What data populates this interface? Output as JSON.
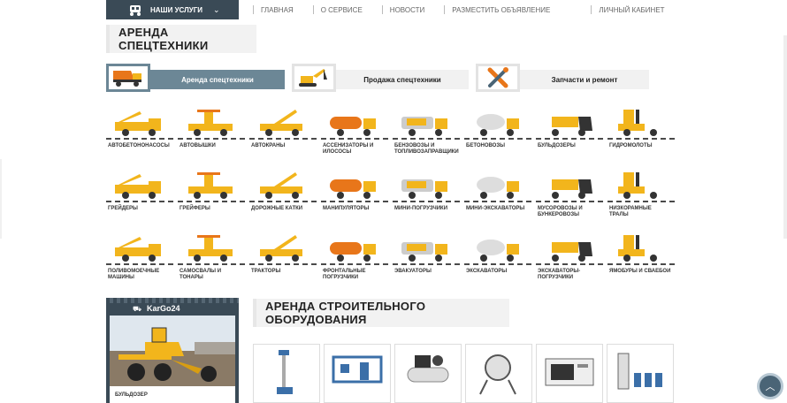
{
  "nav": {
    "services_label": "НАШИ УСЛУГИ",
    "links": [
      "ГЛАВНАЯ",
      "О СЕРВИСЕ",
      "НОВОСТИ",
      "РАЗМЕСТИТЬ ОБЪЯВЛЕНИЕ",
      "ЛИЧНЫЙ КАБИНЕТ"
    ]
  },
  "rental_section": {
    "title": "АРЕНДА СПЕЦТЕХНИКИ"
  },
  "tabs": [
    {
      "label": "Аренда спецтехники",
      "icon": "dump-truck-icon",
      "active": true
    },
    {
      "label": "Продажа спецтехники",
      "icon": "excavator-icon",
      "active": false
    },
    {
      "label": "Запчасти и ремонт",
      "icon": "wrench-screwdriver-icon",
      "active": false
    }
  ],
  "machines": [
    [
      "АВТОБЕТОНОНАСОСЫ"
    ],
    [
      "АВТОВЫШКИ"
    ],
    [
      "АВТОКРАНЫ"
    ],
    [
      "АССЕНИЗАТОРЫ И",
      "ИЛОСОСЫ"
    ],
    [
      "БЕНЗОВОЗЫ И",
      "ТОПЛИВОЗАПРАВЩИКИ"
    ],
    [
      "БЕТОНОВОЗЫ"
    ],
    [
      "БУЛЬДОЗЕРЫ"
    ],
    [
      "ГИДРОМОЛОТЫ"
    ],
    [
      "ГРЕЙДЕРЫ"
    ],
    [
      "ГРЕЙФЕРЫ"
    ],
    [
      "ДОРОЖНЫЕ КАТКИ"
    ],
    [
      "МАНИПУЛЯТОРЫ"
    ],
    [
      "МИНИ-ПОГРУЗЧИКИ"
    ],
    [
      "МИНИ-ЭКСКАВАТОРЫ"
    ],
    [
      "МУСОРОВОЗЫ И",
      "БУНКЕРОВОЗЫ"
    ],
    [
      "НИЗКОРАМНЫЕ",
      "ТРАЛЫ"
    ],
    [
      "ПОЛИВОМОЕЧНЫЕ",
      "МАШИНЫ"
    ],
    [
      "САМОСВАЛЫ И",
      "ТОНАРЫ"
    ],
    [
      "ТРАКТОРЫ"
    ],
    [
      "ФРОНТАЛЬНЫЕ",
      "ПОГРУЗЧИКИ"
    ],
    [
      "ЭВАКУАТОРЫ"
    ],
    [
      "ЭКСКАВАТОРЫ"
    ],
    [
      "ЭКСКАВАТОРЫ-",
      "ПОГРУЗЧИКИ"
    ],
    [
      "ЯМОБУРЫ И СВАЕБОИ"
    ]
  ],
  "promo": {
    "brand": "KarGo24",
    "caption": "БУЛЬДОЗЕР"
  },
  "equipment_section": {
    "title": "АРЕНДА СТРОИТЕЛЬНОГО ОБОРУДОВАНИЯ"
  },
  "equipment": [
    "lift-icon",
    "container-icon",
    "compressor-icon",
    "concrete-mixer-icon",
    "generator-icon",
    "pump-station-icon"
  ],
  "colors": {
    "accent": "#6c8796",
    "dark": "#3a4a56",
    "machine_yellow": "#f2b51c"
  },
  "scroll_top_icon": "arrow-up-icon"
}
